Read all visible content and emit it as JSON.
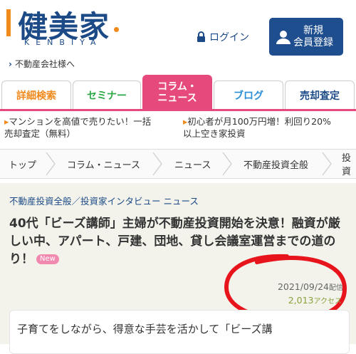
{
  "header": {
    "logo_text": "健美家",
    "logo_sub": "KENBIYA",
    "login_label": "ログイン",
    "register_label_line1": "新規",
    "register_label_line2": "会員登録",
    "company_link": "不動産会社様へ",
    "accent_color": "#f08a1c",
    "brand_color": "#1b4a86"
  },
  "tabs": [
    {
      "label": "詳細検索",
      "color": "#f08a1c"
    },
    {
      "label": "セミナー",
      "color": "#2aa845"
    },
    {
      "label_line1": "コラム・",
      "label_line2": "ニュース",
      "active": true
    },
    {
      "label": "ブログ",
      "color": "#2a8fd6"
    },
    {
      "label": "売却査定",
      "color": "#1b4a86"
    }
  ],
  "promos": [
    {
      "line1": "マンションを高値で売りたい！一括",
      "line2": "売却査定（無料）"
    },
    {
      "line1": "初心者が月100万円増！利回り20%",
      "line2": "以上空き家投資"
    }
  ],
  "breadcrumb": [
    "トップ",
    "コラム・ニュース",
    "ニュース",
    "不動産投資全般",
    "投資"
  ],
  "article": {
    "category": "不動産投資全般／投資家インタビュー ニュース",
    "title": "40代「ビーズ講師」主婦が不動産投資開始を決意！融資が厳しい中、アパート、戸建、団地、貸し会議室運営までの道のり！",
    "badge": "New",
    "date": "2021/09/24",
    "date_suffix": "配信",
    "views": "2,013",
    "views_suffix": "アクセス",
    "body_line1": "子育てをしながら、得意な手芸を活かして「ビーズ講"
  }
}
